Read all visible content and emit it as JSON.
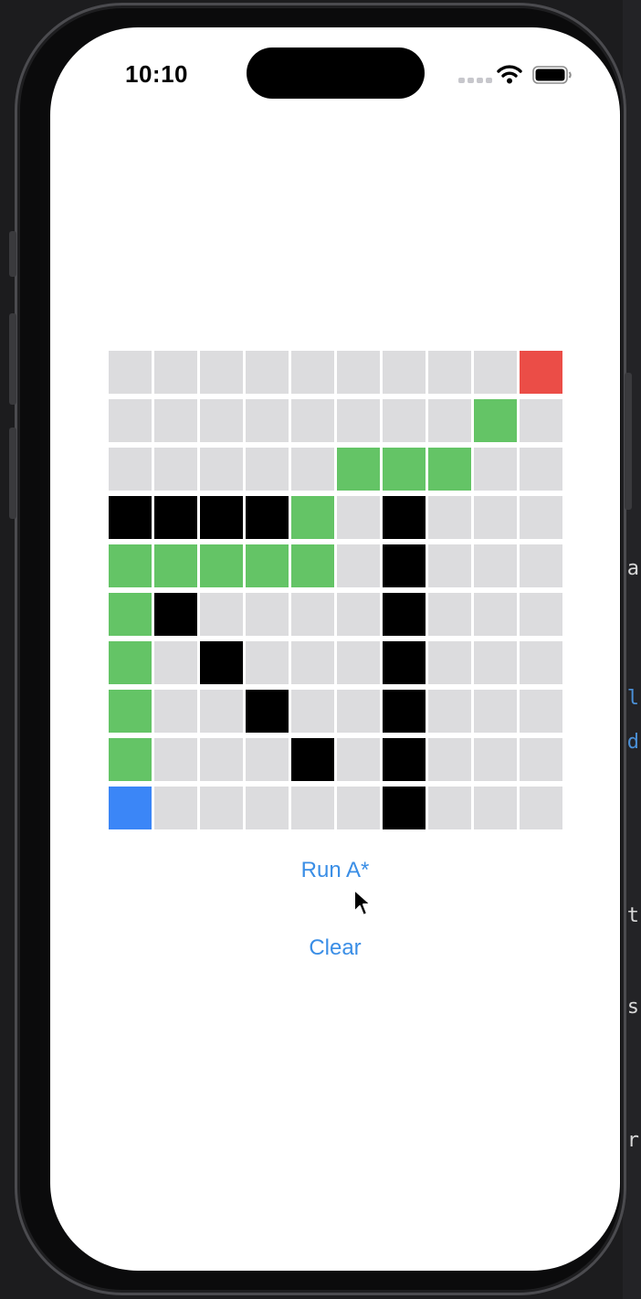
{
  "status_bar": {
    "time": "10:10",
    "icons": [
      "signal-dots-icon",
      "wifi-icon",
      "battery-icon"
    ]
  },
  "grid": {
    "rows": 10,
    "cols": 10,
    "cells": [
      [
        "empty",
        "empty",
        "empty",
        "empty",
        "empty",
        "empty",
        "empty",
        "empty",
        "empty",
        "goal"
      ],
      [
        "empty",
        "empty",
        "empty",
        "empty",
        "empty",
        "empty",
        "empty",
        "empty",
        "path",
        "empty"
      ],
      [
        "empty",
        "empty",
        "empty",
        "empty",
        "empty",
        "path",
        "path",
        "path",
        "empty",
        "empty"
      ],
      [
        "wall",
        "wall",
        "wall",
        "wall",
        "path",
        "empty",
        "wall",
        "empty",
        "empty",
        "empty"
      ],
      [
        "path",
        "path",
        "path",
        "path",
        "path",
        "empty",
        "wall",
        "empty",
        "empty",
        "empty"
      ],
      [
        "path",
        "wall",
        "empty",
        "empty",
        "empty",
        "empty",
        "wall",
        "empty",
        "empty",
        "empty"
      ],
      [
        "path",
        "empty",
        "wall",
        "empty",
        "empty",
        "empty",
        "wall",
        "empty",
        "empty",
        "empty"
      ],
      [
        "path",
        "empty",
        "empty",
        "wall",
        "empty",
        "empty",
        "wall",
        "empty",
        "empty",
        "empty"
      ],
      [
        "path",
        "empty",
        "empty",
        "empty",
        "wall",
        "empty",
        "wall",
        "empty",
        "empty",
        "empty"
      ],
      [
        "start",
        "empty",
        "empty",
        "empty",
        "empty",
        "empty",
        "wall",
        "empty",
        "empty",
        "empty"
      ]
    ],
    "colors": {
      "empty": "#dcdcde",
      "wall": "#000000",
      "path": "#64c466",
      "start": "#3b86f7",
      "goal": "#eb4d47"
    }
  },
  "actions": {
    "run_label": "Run A*",
    "clear_label": "Clear"
  },
  "accent_color": "#3a8ee6"
}
